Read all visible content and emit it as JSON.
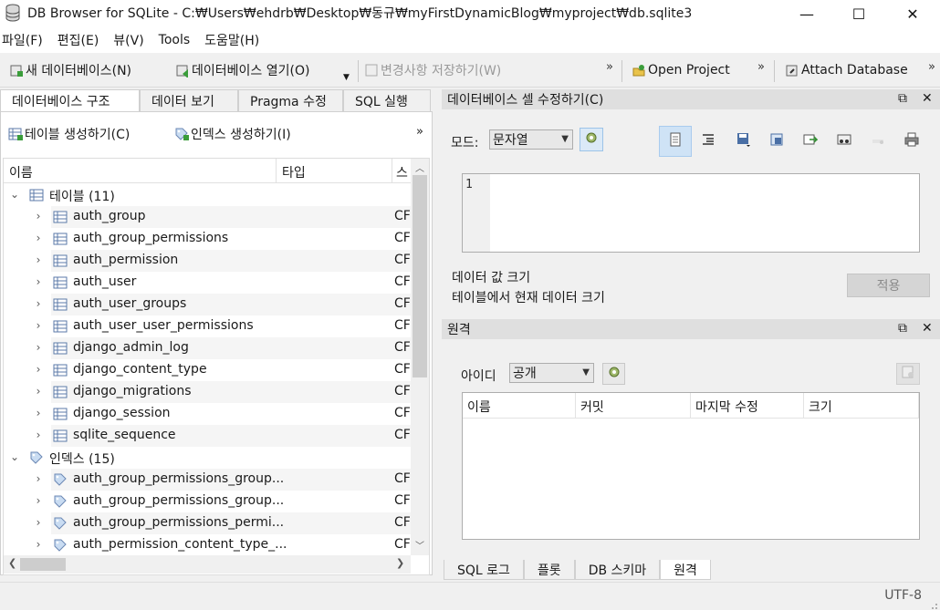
{
  "window": {
    "title": "DB Browser for SQLite - C:₩Users₩ehdrb₩Desktop₩동규₩myFirstDynamicBlog₩myproject₩db.sqlite3",
    "minimize": "—",
    "maximize": "☐",
    "close": "✕"
  },
  "menu": [
    "파일(F)",
    "편집(E)",
    "뷰(V)",
    "Tools",
    "도움말(H)"
  ],
  "toolbar": {
    "new_db": "새 데이터베이스(N)",
    "open_db": "데이터베이스 열기(O)",
    "save_changes": "변경사항 저장하기(W)",
    "open_project": "Open Project",
    "attach_db": "Attach Database",
    "more": "»"
  },
  "left_tabs": [
    "데이터베이스 구조",
    "데이터 보기",
    "Pragma 수정",
    "SQL 실행"
  ],
  "structure": {
    "create_table": "테이블 생성하기(C)",
    "create_index": "인덱스 생성하기(I)",
    "more": "»",
    "columns": {
      "name": "이름",
      "type": "타입",
      "schema": "스"
    },
    "tables_group": "테이블 (11)",
    "indexes_group": "인덱스 (15)",
    "tables": [
      "auth_group",
      "auth_group_permissions",
      "auth_permission",
      "auth_user",
      "auth_user_groups",
      "auth_user_user_permissions",
      "django_admin_log",
      "django_content_type",
      "django_migrations",
      "django_session",
      "sqlite_sequence"
    ],
    "indexes": [
      "auth_group_permissions_group...",
      "auth_group_permissions_group...",
      "auth_group_permissions_permi...",
      "auth_permission_content_type_..."
    ],
    "schema_prefix": "CF"
  },
  "edit_cell": {
    "title": "데이터베이스 셀 수정하기(C)",
    "mode_label": "모드:",
    "mode_value": "문자열",
    "line_number": "1",
    "data_size_label": "데이터 값 크기",
    "table_size_label": "테이블에서 현재 데이터 크기",
    "apply": "적용"
  },
  "remote": {
    "title": "원격",
    "id_label": "아이디",
    "id_value": "공개",
    "columns": [
      "이름",
      "커밋",
      "마지막 수정",
      "크기"
    ]
  },
  "bottom_tabs": [
    "SQL 로그",
    "플롯",
    "DB 스키마",
    "원격"
  ],
  "status": {
    "encoding": "UTF-8"
  },
  "dock_buttons": {
    "float": "⧉",
    "close": "✕"
  }
}
